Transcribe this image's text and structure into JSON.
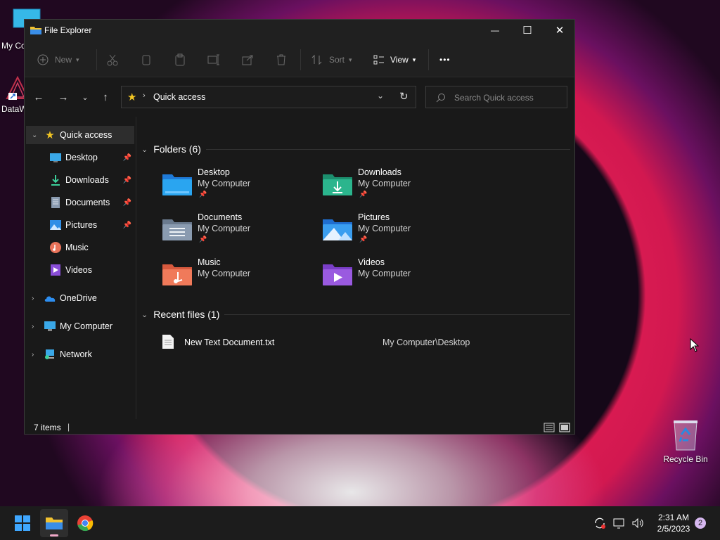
{
  "desktop": {
    "icon1_label": "My Co",
    "icon2_label": "DataW",
    "recycle_bin_label": "Recycle Bin"
  },
  "window": {
    "title": "File Explorer",
    "minimize": "—",
    "maximize": "☐",
    "close": "✕"
  },
  "toolbar": {
    "new_label": "New",
    "sort_label": "Sort",
    "view_label": "View",
    "more_label": "•••"
  },
  "address": {
    "location": "Quick access",
    "search_placeholder": "Search Quick access"
  },
  "sidebar": {
    "quick_access": "Quick access",
    "pinned": [
      {
        "label": "Desktop"
      },
      {
        "label": "Downloads"
      },
      {
        "label": "Documents"
      },
      {
        "label": "Pictures"
      }
    ],
    "music": "Music",
    "videos": "Videos",
    "onedrive": "OneDrive",
    "my_computer": "My Computer",
    "network": "Network"
  },
  "folders_group": {
    "title": "Folders (6)",
    "items": [
      {
        "name": "Desktop",
        "sub": "My Computer",
        "pinned": true,
        "color": "#2aa5f0"
      },
      {
        "name": "Downloads",
        "sub": "My Computer",
        "pinned": true,
        "color": "#2bb58d"
      },
      {
        "name": "Documents",
        "sub": "My Computer",
        "pinned": true,
        "color": "#8a9bb0"
      },
      {
        "name": "Pictures",
        "sub": "My Computer",
        "pinned": true,
        "color": "#3a9ef0"
      },
      {
        "name": "Music",
        "sub": "My Computer",
        "pinned": false,
        "color": "#f07a5a"
      },
      {
        "name": "Videos",
        "sub": "My Computer",
        "pinned": false,
        "color": "#9a5ae0"
      }
    ]
  },
  "recent_group": {
    "title": "Recent files (1)",
    "files": [
      {
        "name": "New Text Document.txt",
        "location": "My Computer\\Desktop"
      }
    ]
  },
  "status": {
    "count": "7 items",
    "cursor": "|"
  },
  "taskbar": {
    "time": "2:31 AM",
    "date": "2/5/2023",
    "notification_count": "2"
  }
}
